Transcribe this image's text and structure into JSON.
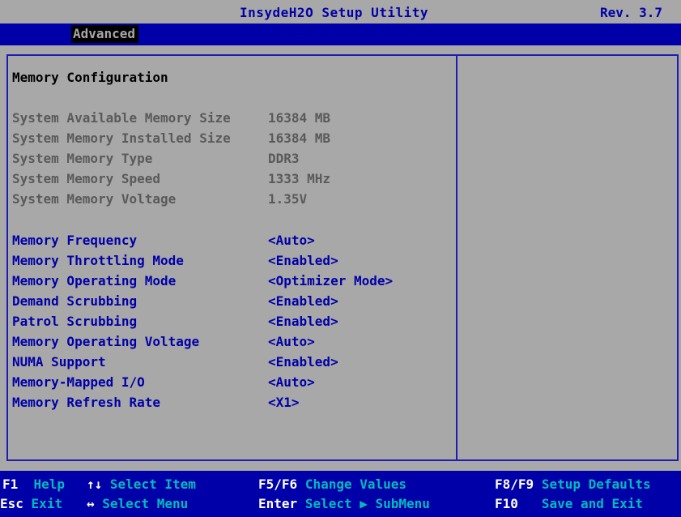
{
  "app": {
    "title": "InsydeH2O Setup Utility",
    "version": "Rev. 3.7"
  },
  "tabs": [
    {
      "label": "Advanced",
      "selected": true
    }
  ],
  "panel": {
    "heading": "Memory Configuration",
    "info_rows": [
      {
        "label": "System Available Memory Size",
        "value": "16384 MB"
      },
      {
        "label": "System Memory Installed Size",
        "value": "16384 MB"
      },
      {
        "label": "System Memory Type",
        "value": "DDR3"
      },
      {
        "label": "System Memory Speed",
        "value": "1333 MHz"
      },
      {
        "label": "System Memory Voltage",
        "value": "1.35V"
      }
    ],
    "setting_rows": [
      {
        "label": "Memory Frequency",
        "value": "<Auto>"
      },
      {
        "label": "Memory Throttling Mode",
        "value": "<Enabled>"
      },
      {
        "label": "Memory Operating Mode",
        "value": "<Optimizer Mode>"
      },
      {
        "label": "Demand Scrubbing",
        "value": "<Enabled>"
      },
      {
        "label": "Patrol Scrubbing",
        "value": "<Enabled>"
      },
      {
        "label": "Memory Operating Voltage",
        "value": "<Auto>"
      },
      {
        "label": "NUMA Support",
        "value": "<Enabled>"
      },
      {
        "label": "Memory-Mapped I/O",
        "value": "<Auto>"
      },
      {
        "label": "Memory Refresh Rate",
        "value": "<X1>"
      }
    ]
  },
  "footer": {
    "f1": {
      "key": "F1",
      "desc": "Help"
    },
    "esc": {
      "key": "Esc",
      "desc": "Exit"
    },
    "updown": {
      "key": "↑↓",
      "desc": "Select Item"
    },
    "leftright": {
      "key": "↔",
      "desc": "Select Menu"
    },
    "f5f6": {
      "key": "F5/F6",
      "desc": "Change Values"
    },
    "enter": {
      "key": "Enter",
      "desc": "Select ▶ SubMenu"
    },
    "f8f9": {
      "key": "F8/F9",
      "desc": "Setup Defaults"
    },
    "f10": {
      "key": "F10",
      "desc": "Save and Exit"
    }
  },
  "colors": {
    "background_gray": "#a8a8a8",
    "bios_blue": "#0000a8",
    "info_text_gray": "#5a5a5a",
    "footer_desc_cyan": "#00bcbc",
    "footer_key_white": "#ffffff"
  }
}
